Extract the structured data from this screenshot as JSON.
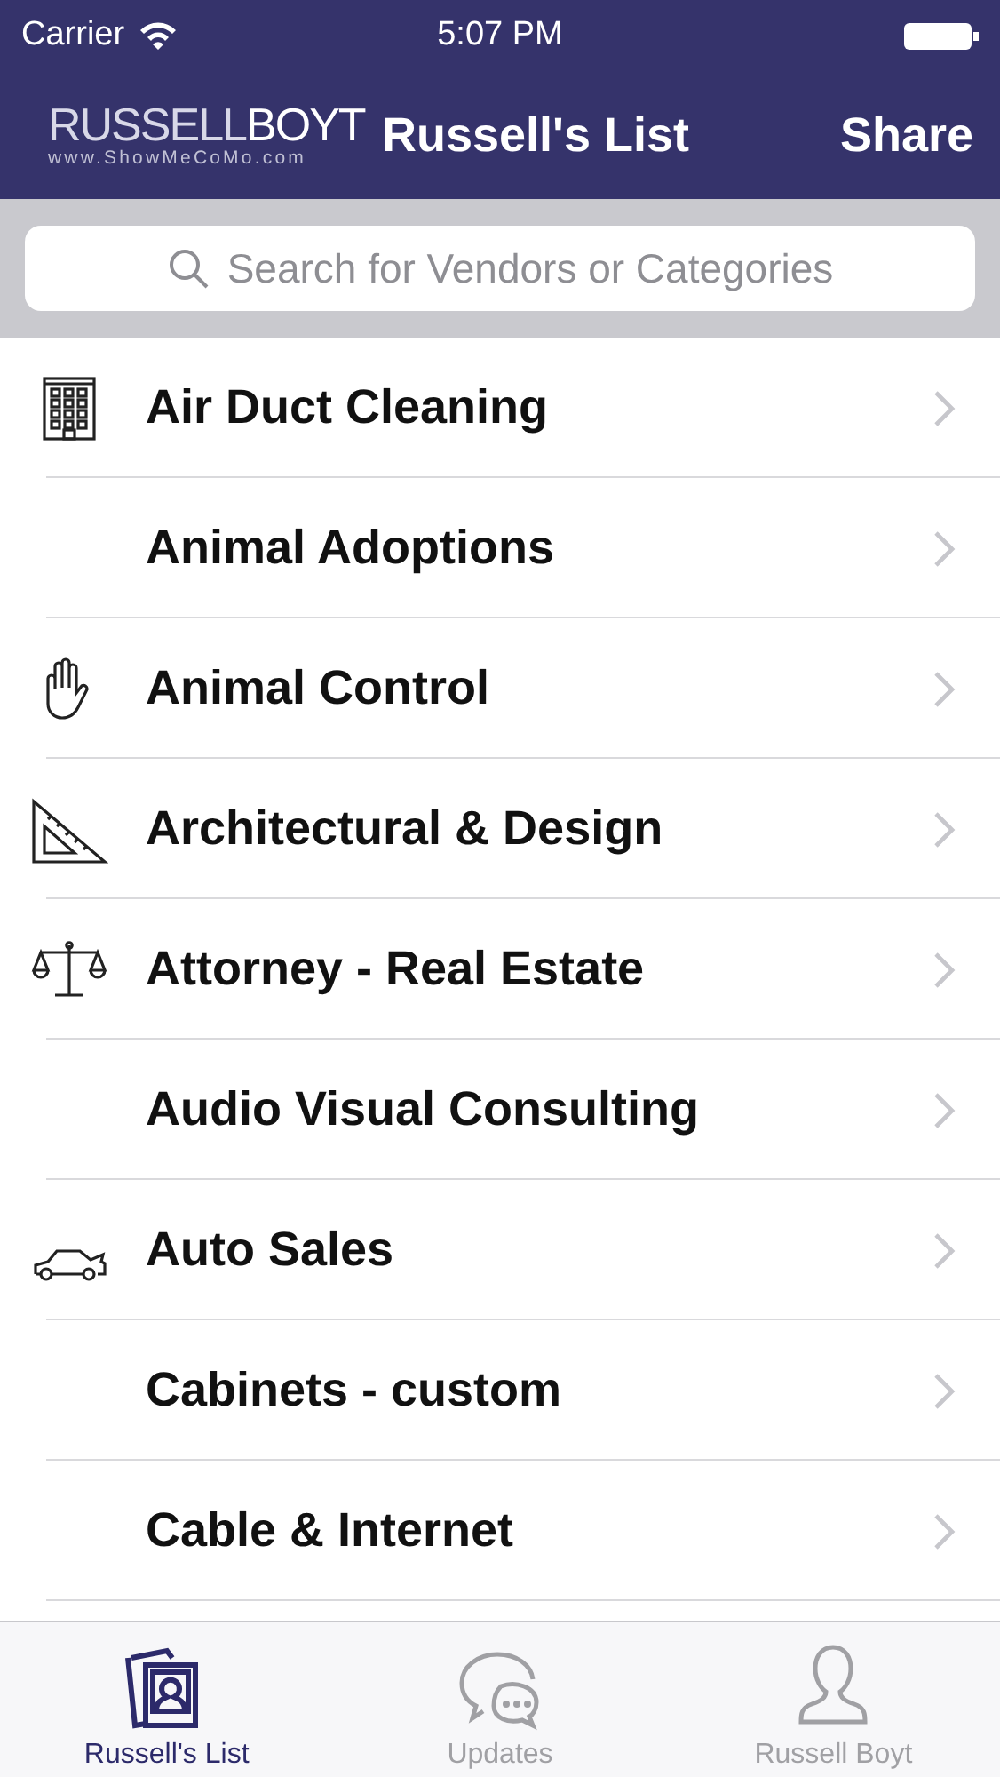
{
  "status_bar": {
    "carrier": "Carrier",
    "time": "5:07 PM"
  },
  "nav": {
    "logo": "RUSSELL**BOYT**",
    "logo_url": "www.ShowMeCoMo.com",
    "title": "Russell's List",
    "action": "Share"
  },
  "search": {
    "placeholder": "Search for Vendors or Categories"
  },
  "categories": [
    {
      "label": "Air Duct Cleaning",
      "kind": "building"
    },
    {
      "label": "Animal Adoptions",
      "kind": "plain"
    },
    {
      "label": "Animal Control",
      "kind": "hand"
    },
    {
      "label": "Architectural & Design",
      "kind": "ruler"
    },
    {
      "label": "Attorney - Real Estate",
      "kind": "scale"
    },
    {
      "label": "Audio Visual Consulting",
      "kind": "plain"
    },
    {
      "label": "Auto Sales",
      "kind": "car"
    },
    {
      "label": "Cabinets - custom",
      "kind": "plain"
    },
    {
      "label": "Cable & Internet",
      "kind": "plain"
    }
  ],
  "tabs": [
    {
      "label": "Russell's List",
      "kind": "photos",
      "selected": true
    },
    {
      "label": "Updates",
      "kind": "chat",
      "selected": false
    },
    {
      "label": "Russell Boyt",
      "kind": "person",
      "selected": false
    }
  ]
}
